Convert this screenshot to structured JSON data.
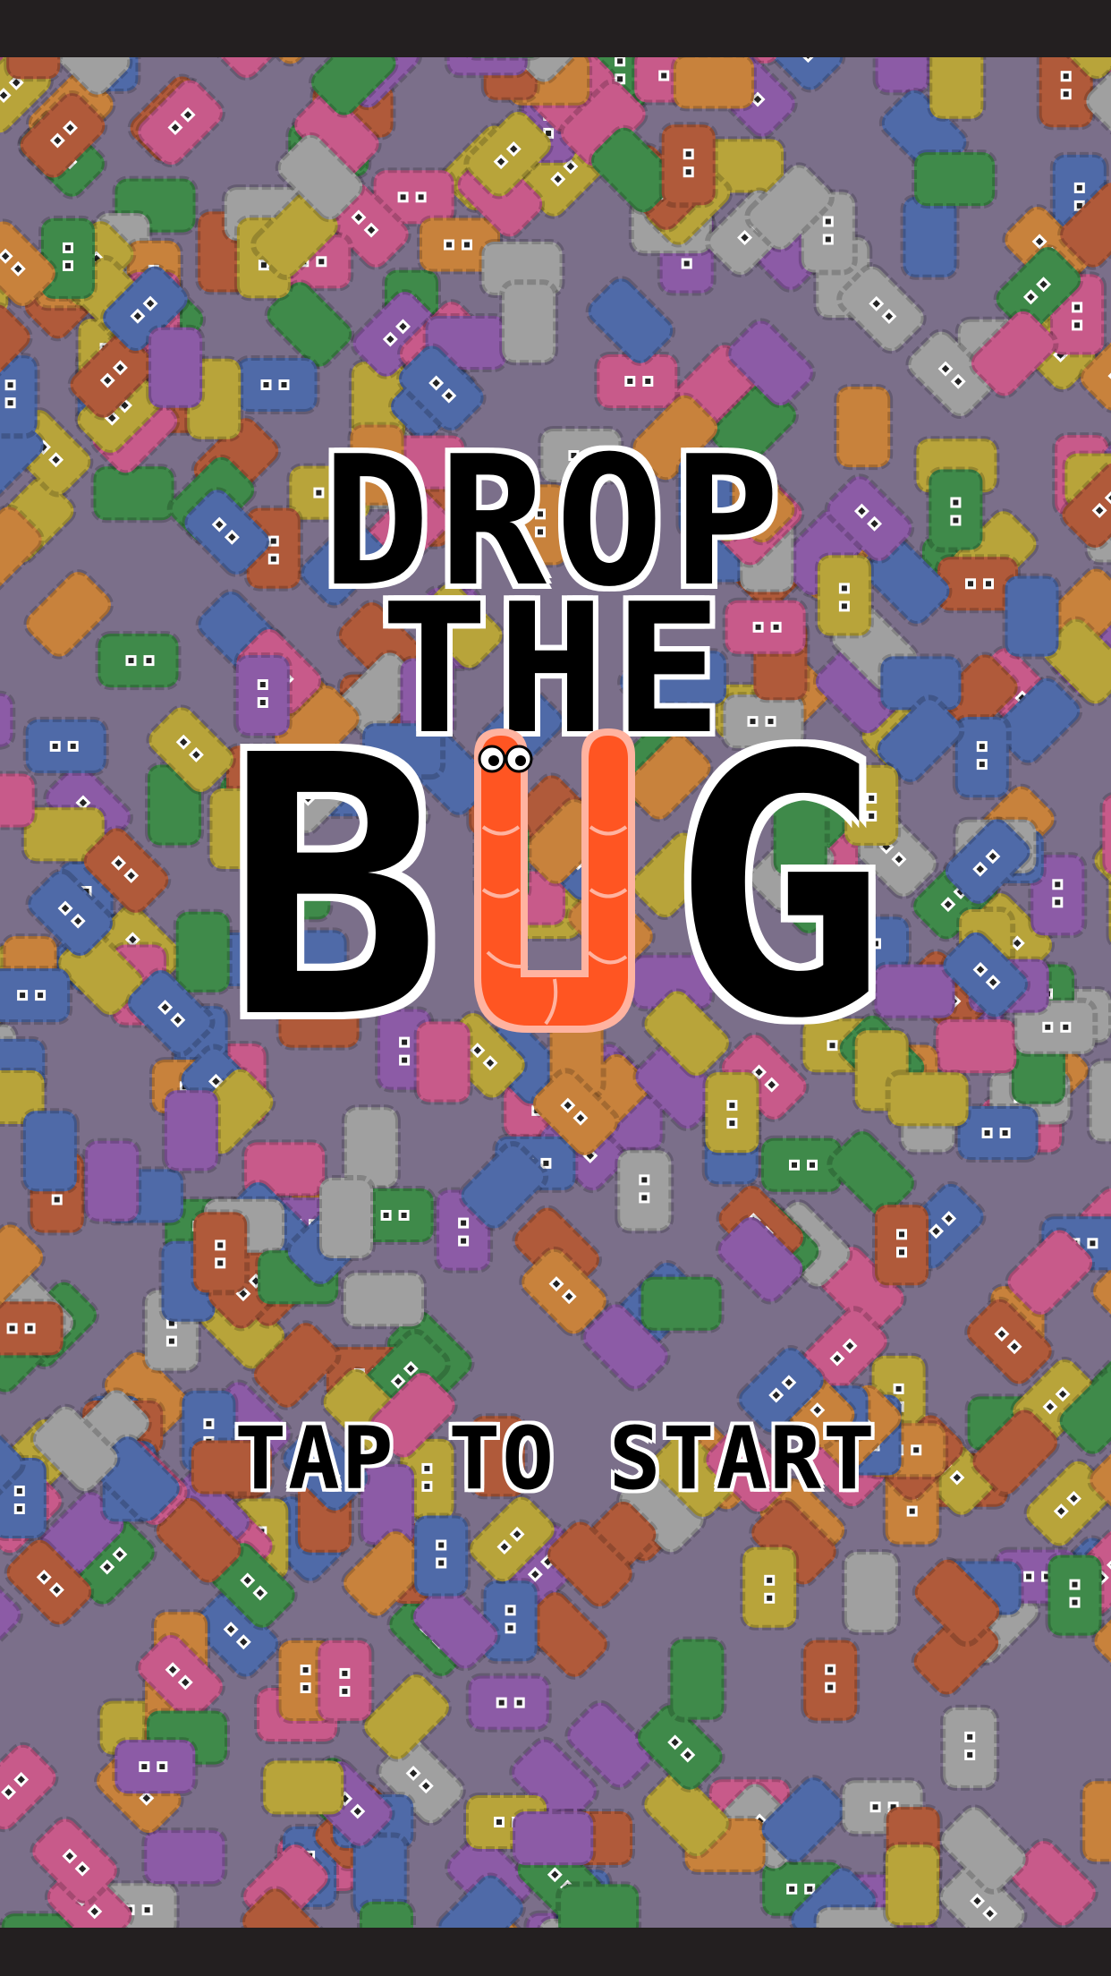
{
  "title": {
    "line1": "DROP",
    "line2": "THE",
    "letter_b": "B",
    "letter_u": "U",
    "letter_g": "G"
  },
  "prompt": {
    "start_label": "TAP TO START"
  },
  "colors": {
    "letterbox": "#231f20",
    "title_fill": "#000000",
    "title_outline": "#ffffff",
    "worm_body": "#ff5522",
    "worm_outline": "#ffb3a0",
    "bug_palette": [
      "#4f6aa8",
      "#c85a8a",
      "#3f8a4a",
      "#8c5ba6",
      "#b8a43a",
      "#c8823c",
      "#a0a0a0",
      "#b05a3a"
    ]
  },
  "icons": {
    "background_bugs": "pixel-bug-icon",
    "worm": "worm-u-icon"
  }
}
